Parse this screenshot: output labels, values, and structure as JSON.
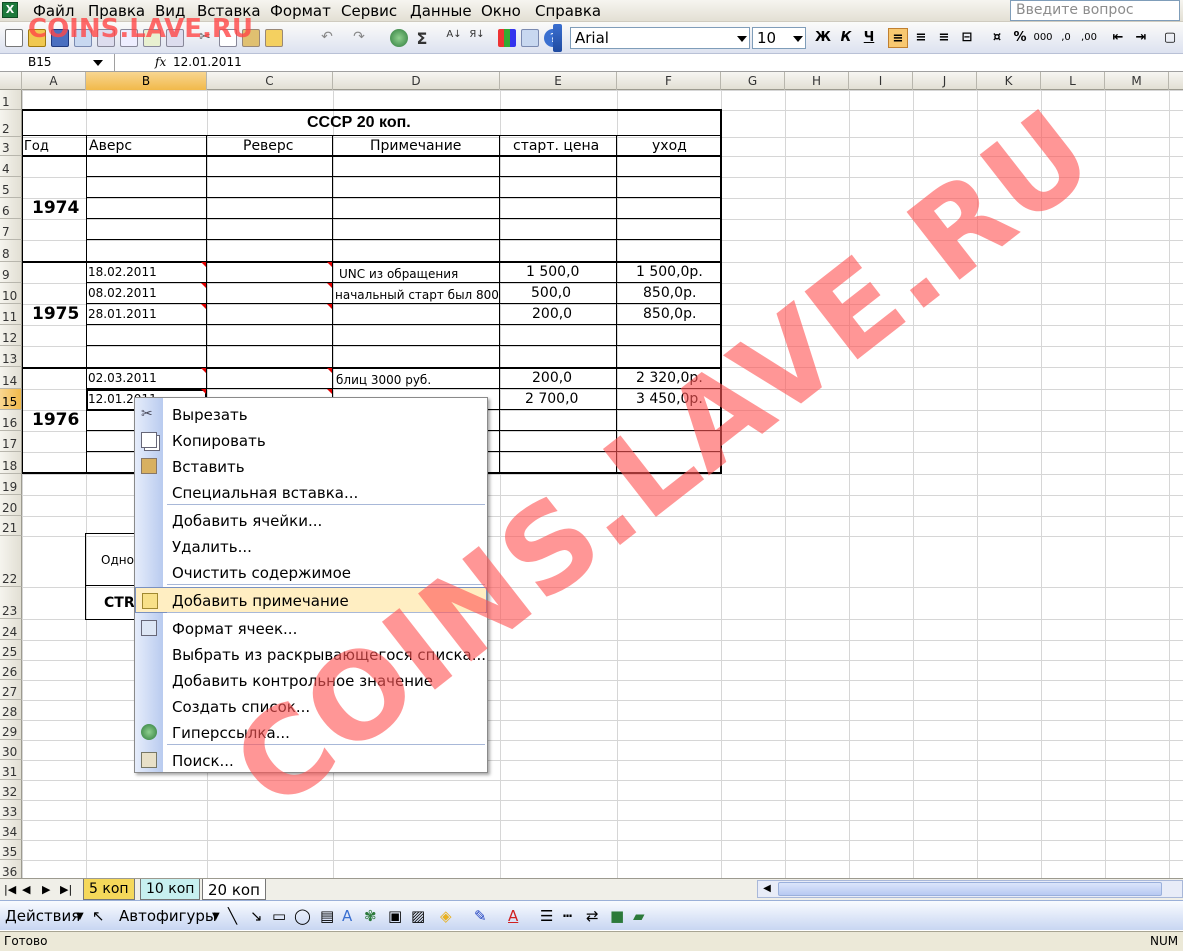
{
  "menubar": {
    "items": [
      "Файл",
      "Правка",
      "Вид",
      "Вставка",
      "Формат",
      "Сервис",
      "Данные",
      "Окно",
      "Справка"
    ],
    "ask_placeholder": "Введите вопрос"
  },
  "toolbar": {
    "font": "Arial",
    "size": "10",
    "bold": "Ж",
    "italic": "К",
    "underline": "Ч",
    "percent": "%",
    "thousands": "000",
    "sigma": "Σ"
  },
  "formula": {
    "namebox": "B15",
    "fx": "fx",
    "value": "12.01.2011"
  },
  "columns": [
    "A",
    "B",
    "C",
    "D",
    "E",
    "F",
    "G",
    "H",
    "I",
    "J",
    "K",
    "L",
    "M"
  ],
  "rows": [
    "1",
    "2",
    "3",
    "4",
    "5",
    "6",
    "7",
    "8",
    "9",
    "10",
    "11",
    "12",
    "13",
    "14",
    "15",
    "16",
    "17",
    "18",
    "19",
    "20",
    "21",
    "22",
    "23",
    "24",
    "25",
    "26",
    "27",
    "28",
    "29",
    "30",
    "31",
    "32",
    "33",
    "34",
    "35",
    "36"
  ],
  "sheet": {
    "title": "СССР  20 коп.",
    "headers": {
      "year": "Год",
      "avers": "Аверс",
      "revers": "Реверс",
      "note": "Примечание",
      "start": "старт. цена",
      "sold": "уход"
    },
    "years": [
      "1974",
      "1975",
      "1976"
    ],
    "r9": {
      "date": "18.02.2011",
      "note": "UNC из обращения",
      "start": "1 500,0",
      "sold": "1 500,0р."
    },
    "r10": {
      "date": "08.02.2011",
      "note": "начальный старт был  800",
      "start": "500,0",
      "sold": "850,0р."
    },
    "r11": {
      "date": "28.01.2011",
      "start": "200,0",
      "sold": "850,0р."
    },
    "r14": {
      "date": "02.03.2011",
      "note": "блиц 3000 руб.",
      "start": "200,0",
      "sold": "2 320,0р."
    },
    "r15": {
      "date": "12.01.2011",
      "start": "2 700,0",
      "sold": "3 450,0р."
    },
    "r22": "Одно",
    "r23": "СТR"
  },
  "context_menu": {
    "items": [
      {
        "label": "Вырезать",
        "icon": "scissors-icon"
      },
      {
        "label": "Копировать",
        "icon": "copy-icon"
      },
      {
        "label": "Вставить",
        "icon": "paste-icon"
      },
      {
        "label": "Специальная вставка..."
      },
      {
        "label": "Добавить ячейки..."
      },
      {
        "label": "Удалить..."
      },
      {
        "label": "Очистить содержимое"
      },
      {
        "label": "Добавить примечание",
        "icon": "comment-icon"
      },
      {
        "label": "Формат ячеек...",
        "icon": "format-cells-icon"
      },
      {
        "label": "Выбрать из раскрывающегося списка..."
      },
      {
        "label": "Добавить контрольное значение"
      },
      {
        "label": "Создать список..."
      },
      {
        "label": "Гиперссылка...",
        "icon": "hyperlink-icon"
      },
      {
        "label": "Поиск...",
        "icon": "research-icon"
      }
    ],
    "highlighted": "Добавить примечание"
  },
  "tabs": [
    "5 коп",
    "10 коп",
    "20 коп"
  ],
  "drawbar": {
    "actions": "Действия",
    "autoshapes": "Автофигуры"
  },
  "status": {
    "left": "Готово",
    "right": "NUM"
  },
  "watermark": "COINS.LAVE.RU",
  "colors": {
    "header_active": "#f1b94a",
    "menu_highlight": "#ffeec2",
    "tab_5": "#f5d85a",
    "tab_10": "#c7f0f0",
    "watermark": "#ff5555"
  }
}
